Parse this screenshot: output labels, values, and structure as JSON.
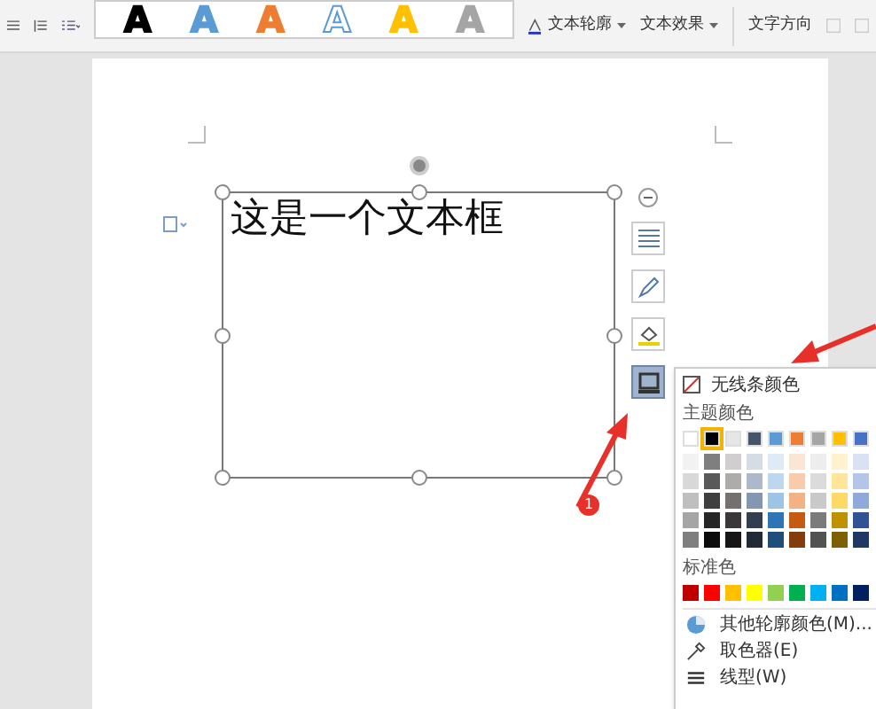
{
  "toolbar": {
    "style_letters": [
      {
        "label": "A",
        "color": "#000000"
      },
      {
        "label": "A",
        "color": "#5b9bd5"
      },
      {
        "label": "A",
        "color": "#ed7d31"
      },
      {
        "label": "A",
        "color": "#ffffff"
      },
      {
        "label": "A",
        "color": "#ffc000"
      },
      {
        "label": "A",
        "color": "#a5a5a5"
      }
    ],
    "text_outline": "文本轮廓",
    "text_effects": "文本效果",
    "text_direction": "文字方向"
  },
  "textbox": {
    "text": "这是一个文本框"
  },
  "side_buttons": [
    {
      "kind": "layout",
      "selected": false
    },
    {
      "kind": "pen",
      "selected": false
    },
    {
      "kind": "fill",
      "selected": false
    },
    {
      "kind": "outline",
      "selected": true
    }
  ],
  "menu": {
    "no_line": "无线条颜色",
    "theme_label": "主题颜色",
    "theme_colors": [
      {
        "color": "#ffffff",
        "selected": false
      },
      {
        "color": "#000000",
        "selected": true
      },
      {
        "color": "#e7e6e6",
        "selected": false
      },
      {
        "color": "#44546a",
        "selected": false
      },
      {
        "color": "#5b9bd5",
        "selected": false
      },
      {
        "color": "#ed7d31",
        "selected": false
      },
      {
        "color": "#a5a5a5",
        "selected": false
      },
      {
        "color": "#ffc000",
        "selected": false
      },
      {
        "color": "#4472c4",
        "selected": false
      }
    ],
    "shades": [
      {
        "swatches": [
          {
            "color": "#f2f2f2"
          },
          {
            "color": "#7f7f7f"
          },
          {
            "color": "#d0cece"
          },
          {
            "color": "#d6dce4"
          },
          {
            "color": "#deebf6"
          },
          {
            "color": "#fbe5d5"
          },
          {
            "color": "#ededed"
          },
          {
            "color": "#fff2cc"
          },
          {
            "color": "#d9e2f3"
          }
        ]
      },
      {
        "swatches": [
          {
            "color": "#d8d8d8"
          },
          {
            "color": "#595959"
          },
          {
            "color": "#aeabab"
          },
          {
            "color": "#adb9ca"
          },
          {
            "color": "#bdd7ee"
          },
          {
            "color": "#f7cbac"
          },
          {
            "color": "#dbdbdb"
          },
          {
            "color": "#fee599"
          },
          {
            "color": "#b4c6e7"
          }
        ]
      },
      {
        "swatches": [
          {
            "color": "#bfbfbf"
          },
          {
            "color": "#3f3f3f"
          },
          {
            "color": "#757070"
          },
          {
            "color": "#8497b0"
          },
          {
            "color": "#9dc3e6"
          },
          {
            "color": "#f4b183"
          },
          {
            "color": "#c9c9c9"
          },
          {
            "color": "#ffd965"
          },
          {
            "color": "#8eaadb"
          }
        ]
      },
      {
        "swatches": [
          {
            "color": "#a5a5a5"
          },
          {
            "color": "#262626"
          },
          {
            "color": "#3a3838"
          },
          {
            "color": "#323f4f"
          },
          {
            "color": "#2e75b5"
          },
          {
            "color": "#c55a11"
          },
          {
            "color": "#7b7b7b"
          },
          {
            "color": "#bf9000"
          },
          {
            "color": "#2f5496"
          }
        ]
      },
      {
        "swatches": [
          {
            "color": "#7f7f7f"
          },
          {
            "color": "#0c0c0c"
          },
          {
            "color": "#171616"
          },
          {
            "color": "#222a35"
          },
          {
            "color": "#1e4e79"
          },
          {
            "color": "#833c0b"
          },
          {
            "color": "#525252"
          },
          {
            "color": "#7f6000"
          },
          {
            "color": "#1f3864"
          }
        ]
      }
    ],
    "standard_label": "标准色",
    "standard_colors": [
      {
        "color": "#c00000"
      },
      {
        "color": "#ff0000"
      },
      {
        "color": "#ffc000"
      },
      {
        "color": "#ffff00"
      },
      {
        "color": "#92d050"
      },
      {
        "color": "#00b050"
      },
      {
        "color": "#00b0f0"
      },
      {
        "color": "#0070c0"
      },
      {
        "color": "#002060"
      }
    ],
    "items": [
      {
        "kind": "more",
        "label": "其他轮廓颜色(M)..."
      },
      {
        "kind": "picker",
        "label": "取色器(E)"
      },
      {
        "kind": "linestyle",
        "label": "线型(W)"
      }
    ]
  },
  "callout": {
    "number": "1"
  }
}
